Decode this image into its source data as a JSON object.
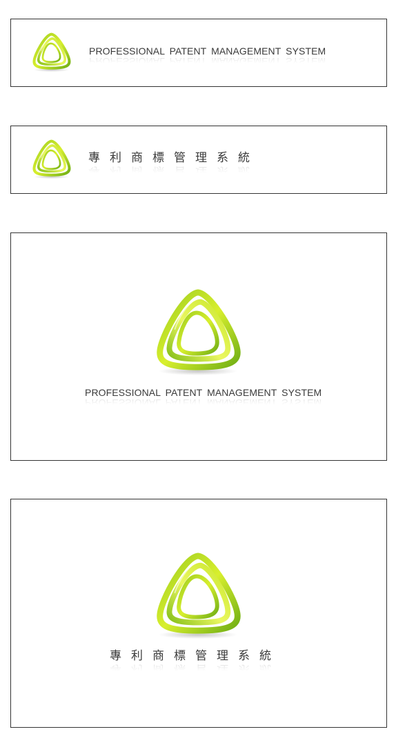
{
  "colors": {
    "logo_green_dark": "#7cb518",
    "logo_green_light": "#d8ef2e",
    "text": "#3a3a3a",
    "border": "#333333"
  },
  "logo": {
    "icon": "concentric-triangle-logo-icon"
  },
  "cards": [
    {
      "variant": "horizontal",
      "text": "PROFESSIONAL  PATENT  MANAGEMENT  SYSTEM"
    },
    {
      "variant": "horizontal",
      "text": "專利商標管理系統"
    },
    {
      "variant": "stacked",
      "text": "PROFESSIONAL  PATENT  MANAGEMENT  SYSTEM"
    },
    {
      "variant": "stacked",
      "text": "專利商標管理系統"
    }
  ]
}
